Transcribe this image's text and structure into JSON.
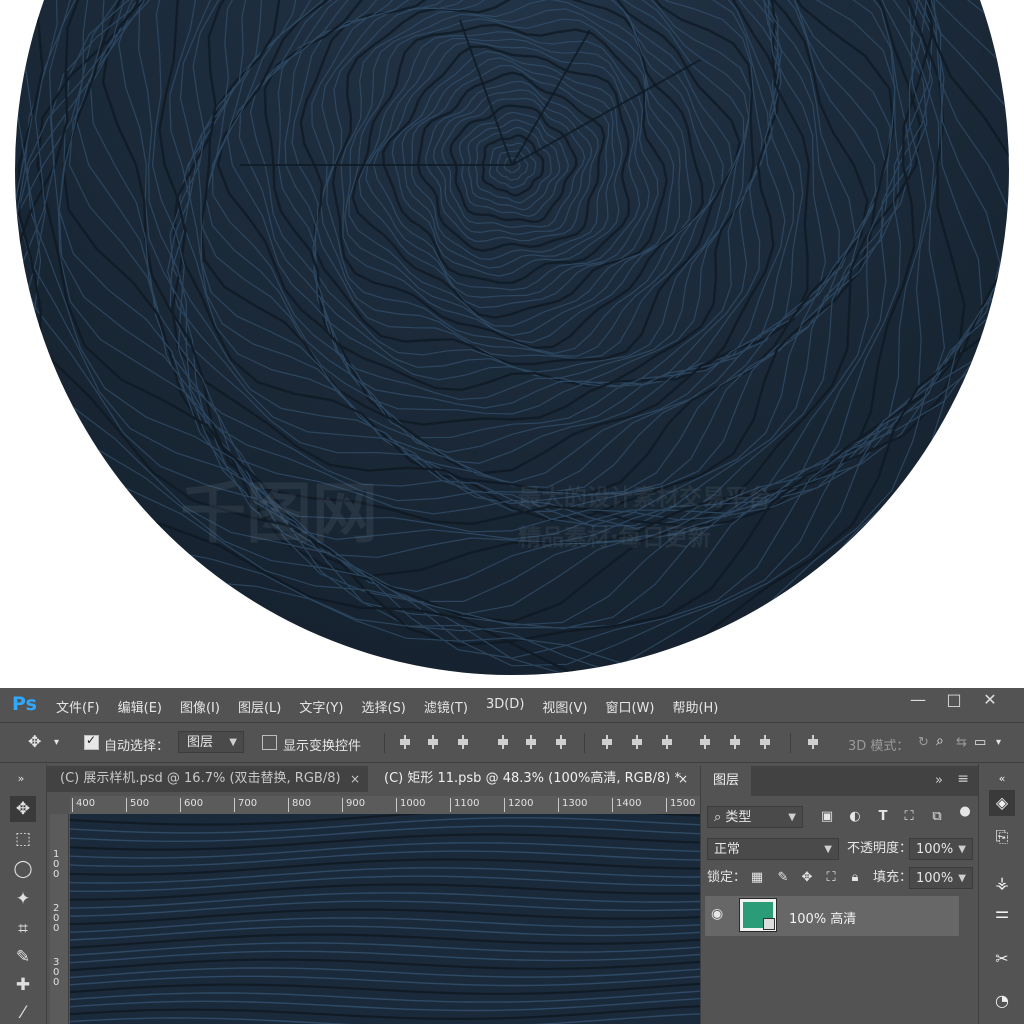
{
  "app": {
    "logo": "Ps"
  },
  "menu": [
    "文件(F)",
    "编辑(E)",
    "图像(I)",
    "图层(L)",
    "文字(Y)",
    "选择(S)",
    "滤镜(T)",
    "3D(D)",
    "视图(V)",
    "窗口(W)",
    "帮助(H)"
  ],
  "window_buttons": {
    "minimize": "—",
    "maximize": "□",
    "close": "✕"
  },
  "options": {
    "auto_select_label": "自动选择：",
    "auto_select_value": "图层",
    "transform_controls_label": "显示变换控件",
    "mode_3d_label": "3D 模式："
  },
  "tabs": [
    {
      "label": "(C) 展示样机.psd @ 16.7% (双击替换, RGB/8)",
      "close": "×"
    },
    {
      "label": "(C) 矩形 11.psb @ 48.3% (100%高清, RGB/8) *",
      "close": "×"
    }
  ],
  "ruler": {
    "top": [
      "400",
      "500",
      "600",
      "700",
      "800",
      "900",
      "1000",
      "1100",
      "1200",
      "1300",
      "1400",
      "1500"
    ],
    "left": [
      "100",
      "200",
      "300"
    ]
  },
  "layers_panel": {
    "title": "图层",
    "filter_label": "类型",
    "blend_mode": "正常",
    "opacity_label": "不透明度：",
    "opacity_value": "100%",
    "lock_label": "锁定：",
    "fill_label": "填充：",
    "fill_value": "100%",
    "layers": [
      {
        "name": "100% 高清"
      }
    ]
  },
  "watermark": {
    "line1": "千图网",
    "line2": "最大的设计素材交易平台",
    "line3": "精品素材·每日更新"
  },
  "colors": {
    "wood_dark": "#1a2a3a",
    "ps_bg": "#535353",
    "layer_thumb": "#2a9d78",
    "logo_blue": "#31a8ff"
  }
}
